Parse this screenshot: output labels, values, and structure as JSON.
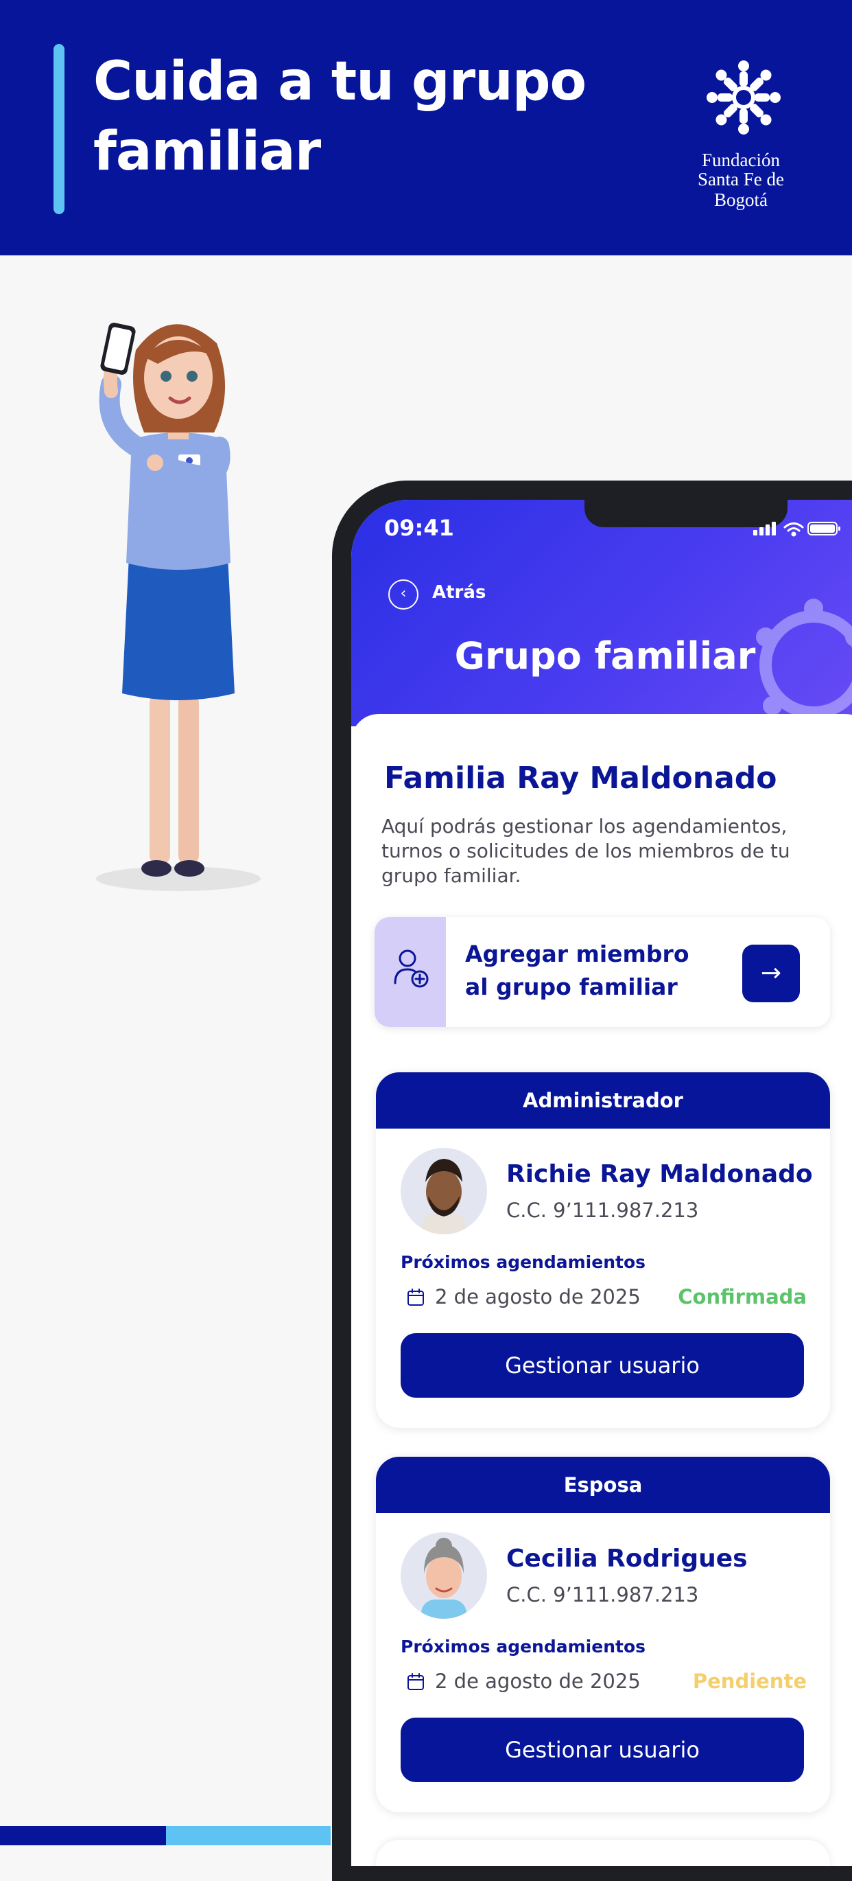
{
  "banner": {
    "title": "Cuida a tu grupo familiar",
    "logo_line1": "Fundación",
    "logo_line2": "Santa Fe de Bogotá",
    "background": "#06159a",
    "accent": "#5ec3f2"
  },
  "phone": {
    "status_time": "09:41",
    "back_label": "Atrás",
    "title": "Grupo familiar",
    "family_name": "Familia Ray Maldonado",
    "description": "Aquí podrás gestionar los agendamientos, turnos o solicitudes de los miembros de tu grupo familiar.",
    "add_member": {
      "label": "Agregar miembro al grupo familiar",
      "icon": "add-user-icon",
      "go_icon": "arrow-right-icon"
    },
    "members": [
      {
        "role": "Administrador",
        "name": "Richie Ray Maldonado",
        "id": "C.C. 9’111.987.213",
        "appointments_label": "Próximos agendamientos",
        "appointment_date": "2 de agosto de 2025",
        "appointment_status": "Confirmada",
        "status_color": "#5cc36a",
        "button": "Gestionar usuario"
      },
      {
        "role": "Esposa",
        "name": "Cecilia Rodrigues",
        "id": "C.C. 9’111.987.213",
        "appointments_label": "Próximos agendamientos",
        "appointment_date": "2 de agosto de 2025",
        "appointment_status": "Pendiente",
        "status_color": "#f5cf6b",
        "button": "Gestionar usuario"
      }
    ]
  },
  "colors": {
    "primary": "#06159a",
    "header_gradient_start": "#2a2fe4",
    "header_gradient_end": "#6a4cf6",
    "add_icon_bg": "#d5cef8"
  }
}
